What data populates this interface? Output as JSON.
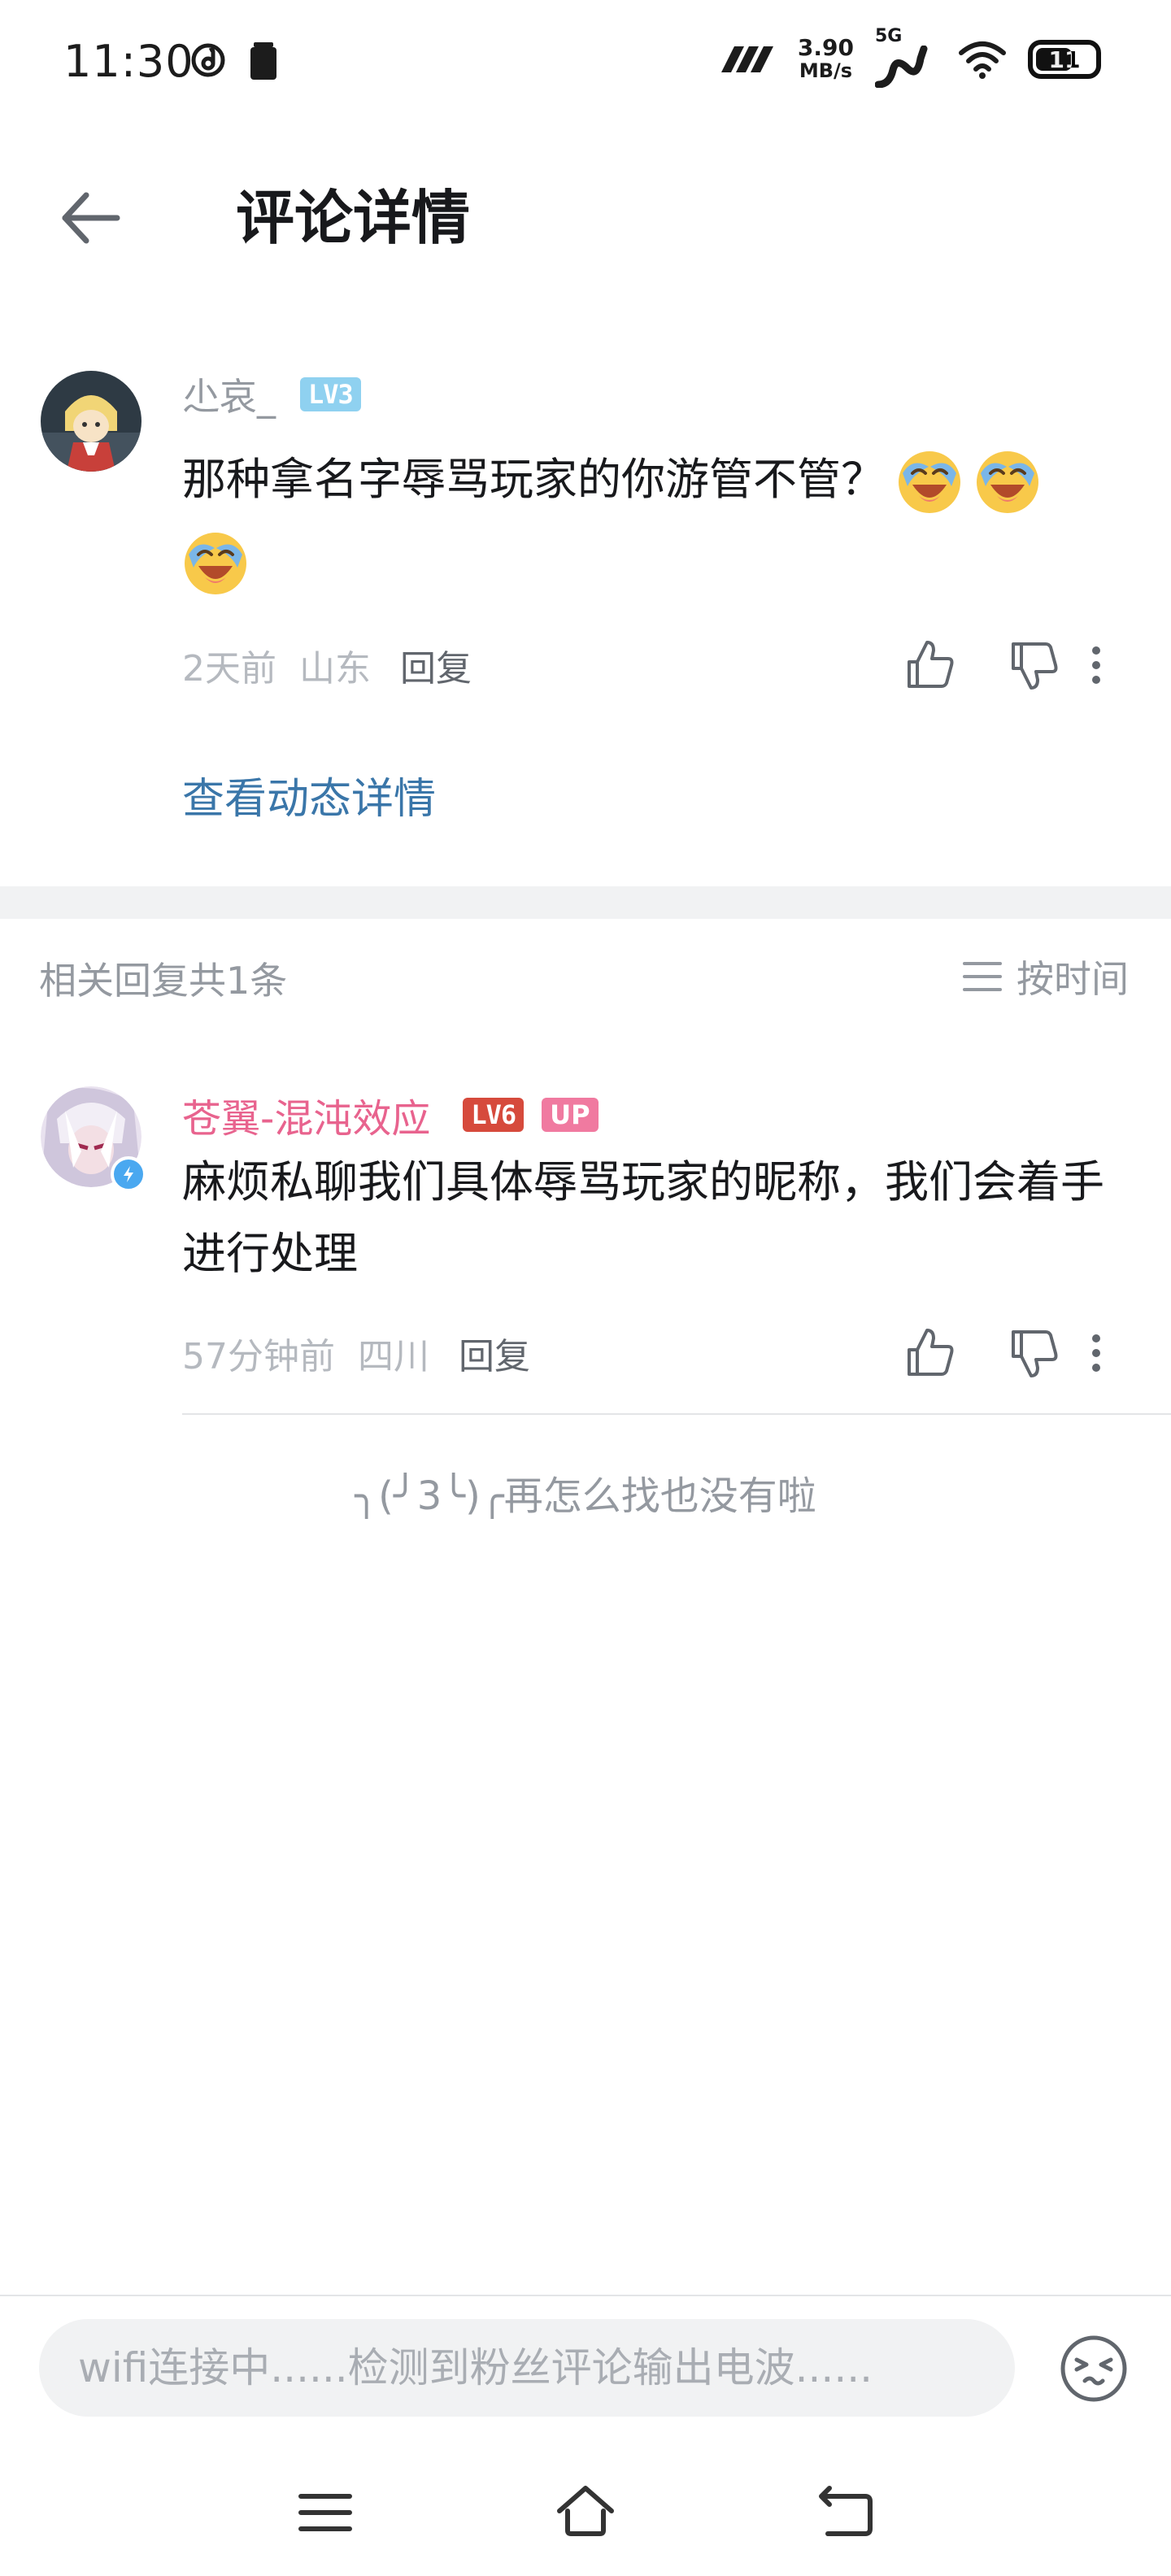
{
  "status_bar": {
    "time": "11:30",
    "net_speed_value": "3.90",
    "net_speed_unit": "MB/s",
    "network": "5G",
    "battery": "11"
  },
  "header": {
    "title": "评论详情"
  },
  "main_comment": {
    "username": "尐哀_",
    "level": "LV3",
    "text": "那种拿名字辱骂玩家的你游管不管？",
    "time": "2天前",
    "location": "山东",
    "reply_label": "回复"
  },
  "view_detail_label": "查看动态详情",
  "replies": {
    "count_label": "相关回复共1条",
    "sort_label": "按时间",
    "items": [
      {
        "username": "苍翼-混沌效应",
        "level": "LV6",
        "badge": "UP",
        "text": "麻烦私聊我们具体辱骂玩家的昵称，我们会着手进行处理",
        "time": "57分钟前",
        "location": "四川",
        "reply_label": "回复"
      }
    ],
    "end_text": "╮(╯3╰)╭再怎么找也没有啦"
  },
  "comment_box": {
    "placeholder": "wifi连接中......检测到粉丝评论输出电波......"
  },
  "colors": {
    "link_blue": "#3a76a9",
    "pink_username": "#e8638e",
    "lv3_badge": "#8fd1f0",
    "lv6_badge": "#d64a3c",
    "up_badge": "#f07aa0"
  }
}
